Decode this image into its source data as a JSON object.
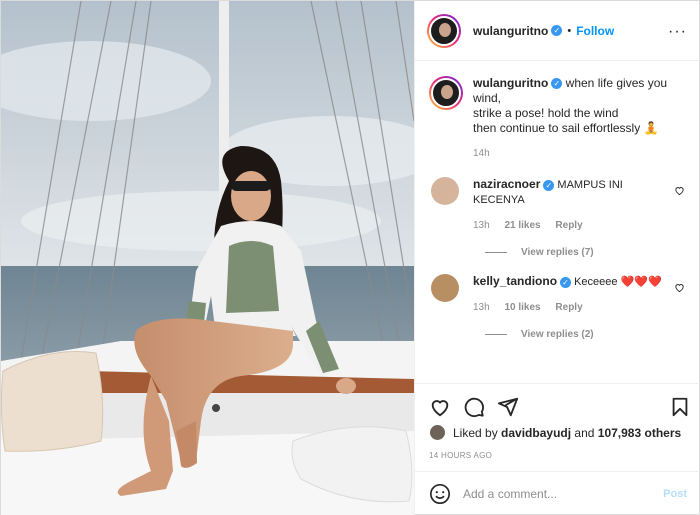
{
  "header": {
    "username": "wulanguritno",
    "follow_label": "Follow",
    "separator": "•"
  },
  "caption": {
    "username": "wulanguritno",
    "line1": "when life gives you wind,",
    "line2": "strike a pose! hold the wind",
    "line3": "then continue to sail effortlessly 🧘",
    "time": "14h"
  },
  "comments": [
    {
      "username": "naziracnoer",
      "text": "MAMPUS INI KECENYA",
      "time": "13h",
      "likes": "21 likes",
      "reply": "Reply",
      "view_replies": "View replies (7)",
      "avatar_color": "#d6b49b"
    },
    {
      "username": "kelly_tandiono",
      "text": "Keceeee ❤️❤️❤️",
      "time": "13h",
      "likes": "10 likes",
      "reply": "Reply",
      "view_replies": "View replies (2)",
      "avatar_color": "#b88f62"
    }
  ],
  "likes": {
    "prefix": "Liked by ",
    "user": "davidbayudj",
    "middle": " and ",
    "count": "107,983 others"
  },
  "timestamp": "14 HOURS AGO",
  "add_comment": {
    "placeholder": "Add a comment...",
    "post_label": "Post"
  },
  "colors": {
    "accent": "#0095f6",
    "verified": "#3897f0",
    "heart": "#ed4956"
  },
  "icons": [
    "heart-icon",
    "comment-icon",
    "share-icon",
    "bookmark-icon",
    "emoji-icon",
    "more-icon",
    "verified-icon"
  ]
}
